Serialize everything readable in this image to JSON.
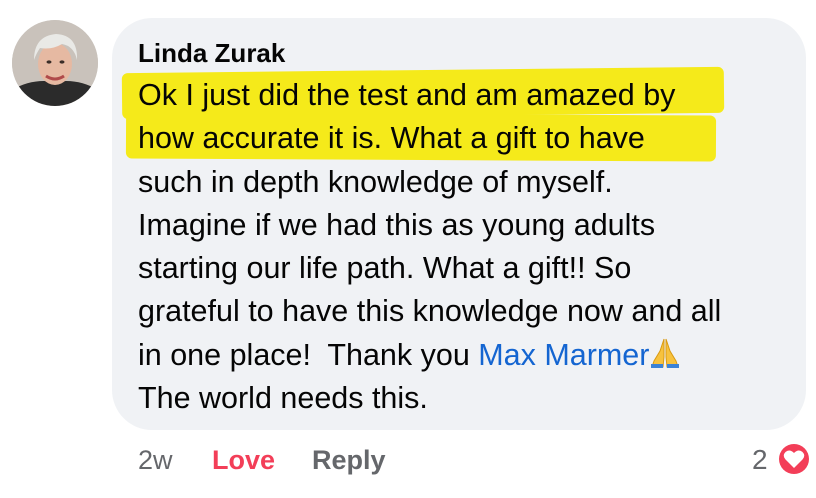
{
  "comment": {
    "author": "Linda Zurak",
    "lines": [
      "Ok I just did the test and am amazed by",
      "how accurate it is.  What a gift to have",
      "such in depth knowledge of myself.",
      "Imagine if we had this as young adults",
      "starting our life path. What a gift!!  So",
      "grateful to have this knowledge now and all",
      "in one place!  Thank you ",
      "The world needs this."
    ],
    "mention": "Max Marmer",
    "highlighted_lines": [
      0,
      1
    ],
    "highlight_color": "#f5ea1a",
    "mention_color": "#1465d1",
    "emoji": "folded-hands-icon"
  },
  "footer": {
    "time": "2w",
    "love_label": "Love",
    "reply_label": "Reply",
    "reaction_count": "2",
    "love_color": "#f33e58"
  }
}
